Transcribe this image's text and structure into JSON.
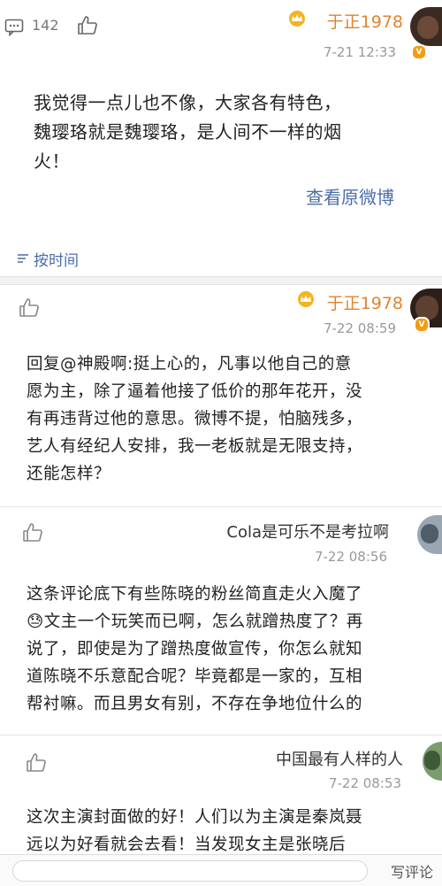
{
  "post": {
    "comment_count": "142",
    "username": "于正1978",
    "time": "7-21 12:33",
    "text_lines": [
      "我觉得一点儿也不像，大家各有特色，",
      "魏璎珞就是魏璎珞，是人间不一样的烟",
      "火！"
    ],
    "view_original": "查看原微博"
  },
  "sort": {
    "label": "按时间"
  },
  "comments": [
    {
      "username": "于正1978",
      "time": "7-22 08:59",
      "text_lines": [
        "回复@神殿啊:挺上心的，凡事以他自己的意",
        "愿为主，除了逼着他接了低价的那年花开，没",
        "有再违背过他的意思。微博不提，怕脑残多，",
        "艺人有经纪人安排，我一老板就是无限支持，",
        "还能怎样？"
      ]
    },
    {
      "username": "Cola是可乐不是考拉啊",
      "time": "7-22 08:56",
      "text_lines": [
        "这条评论底下有些陈晓的粉丝简直走火入魔了",
        "😓文主一个玩笑而已啊，怎么就蹭热度了？再",
        "说了，即使是为了蹭热度做宣传，你怎么就知",
        "道陈晓不乐意配合呢？毕竟都是一家的，互相",
        "帮衬嘛。而且男女有别，不存在争地位什么的"
      ]
    },
    {
      "username": "中国最有人样的人",
      "time": "7-22 08:53",
      "text_lines": [
        "这次主演封面做的好！人们以为主演是秦岚聂",
        "远以为好看就会去看！当发现女主是张晓后"
      ]
    }
  ],
  "bottom": {
    "placeholder_label": "写评论"
  },
  "colors": {
    "accent": "#e3832d",
    "link": "#4a6ea9",
    "muted": "#999999"
  }
}
